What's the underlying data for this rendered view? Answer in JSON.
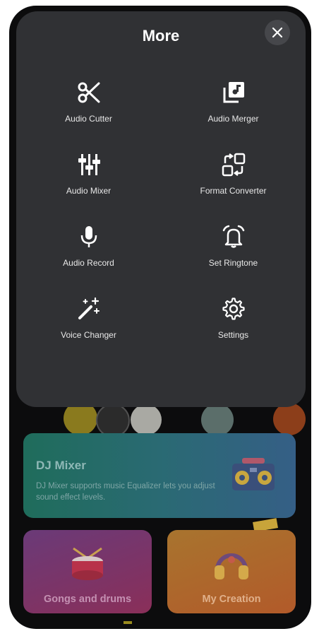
{
  "sheet": {
    "title": "More",
    "items": [
      {
        "label": "Audio Cutter",
        "icon": "scissors-icon"
      },
      {
        "label": "Audio Merger",
        "icon": "merge-stack-icon"
      },
      {
        "label": "Audio Mixer",
        "icon": "mixer-sliders-icon"
      },
      {
        "label": "Format Converter",
        "icon": "format-convert-icon"
      },
      {
        "label": "Audio Record",
        "icon": "microphone-icon"
      },
      {
        "label": "Set Ringtone",
        "icon": "alarm-bell-icon"
      },
      {
        "label": "Voice Changer",
        "icon": "magic-wand-icon"
      },
      {
        "label": "Settings",
        "icon": "gear-icon"
      }
    ]
  },
  "background": {
    "dj_card": {
      "title": "DJ Mixer",
      "description": "DJ Mixer supports music Equalizer lets you adjust sound effect levels."
    },
    "cards": [
      {
        "label": "Gongs and drums"
      },
      {
        "label": "My Creation"
      }
    ]
  },
  "colors": {
    "sheet_bg": "#303134",
    "icon_color": "#ffffff",
    "frame": "#0c0c0d"
  }
}
